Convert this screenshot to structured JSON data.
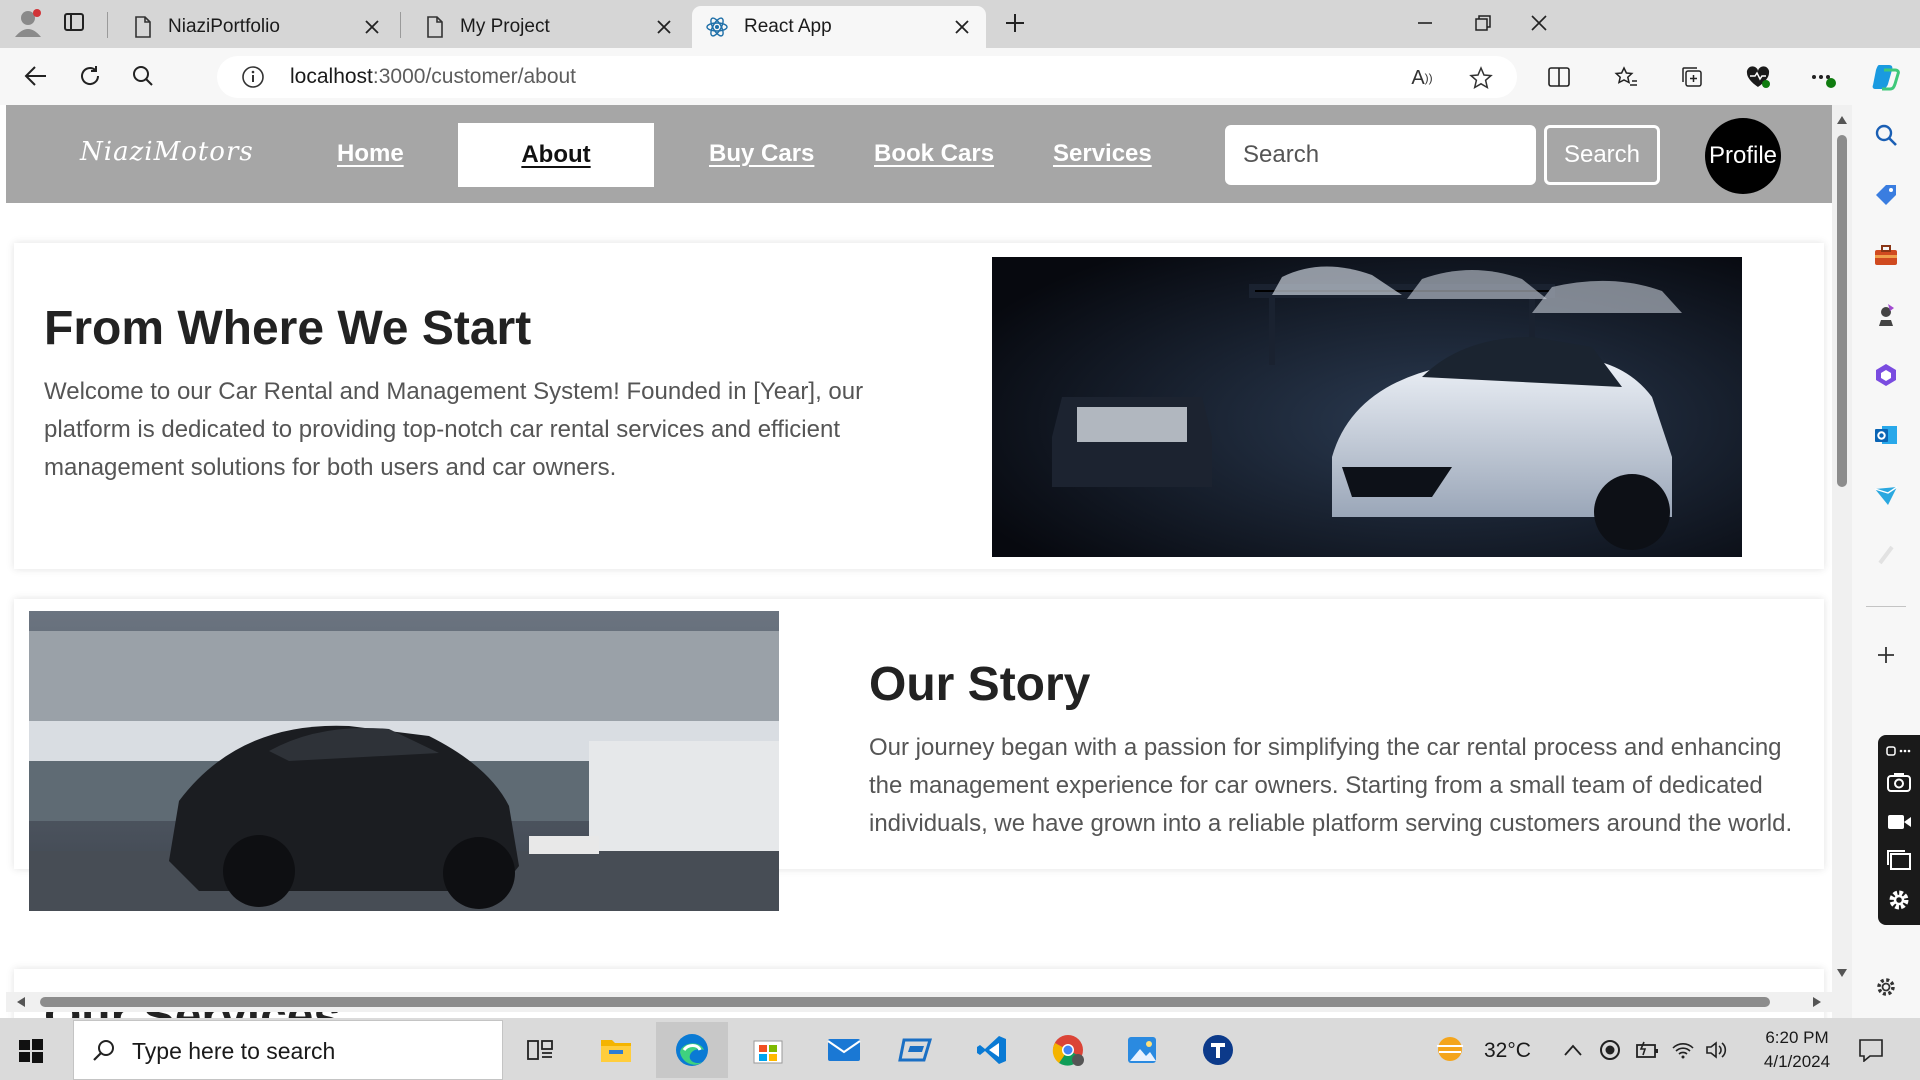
{
  "browser": {
    "tabs": [
      {
        "title": "NiaziPortfolio",
        "active": false
      },
      {
        "title": "My Project",
        "active": false
      },
      {
        "title": "React App",
        "active": true
      }
    ],
    "url_host": "localhost",
    "url_path": ":3000/customer/about",
    "read_aloud_label": "A"
  },
  "site": {
    "logo": "NiaziMotors",
    "nav": {
      "home": "Home",
      "about": "About",
      "buy_cars": "Buy Cars",
      "book_cars": "Book Cars",
      "services": "Services"
    },
    "search": {
      "placeholder": "Search",
      "button": "Search"
    },
    "profile_label": "Profile"
  },
  "sections": {
    "start": {
      "title": "From Where We Start",
      "text": "Welcome to our Car Rental and Management System! Founded in [Year], our platform is dedicated to providing top-notch car rental services and efficient management solutions for both users and car owners.",
      "image_icon": "white-sports-car-in-garage"
    },
    "story": {
      "title": "Our Story",
      "text": "Our journey began with a passion for simplifying the car rental process and enhancing the management experience for car owners. Starting from a small team of dedicated individuals, we have grown into a reliable platform serving customers around the world.",
      "image_icon": "black-sports-car-at-harbor"
    },
    "services": {
      "title": "Our Services"
    }
  },
  "taskbar": {
    "search_placeholder": "Type here to search",
    "temperature": "32°C",
    "time": "6:20 PM",
    "date": "4/1/2024"
  },
  "colors": {
    "navbar": "#a6a6a6",
    "tabstrip": "#d6d6d6",
    "accent_edge": "#0a7ad4"
  }
}
